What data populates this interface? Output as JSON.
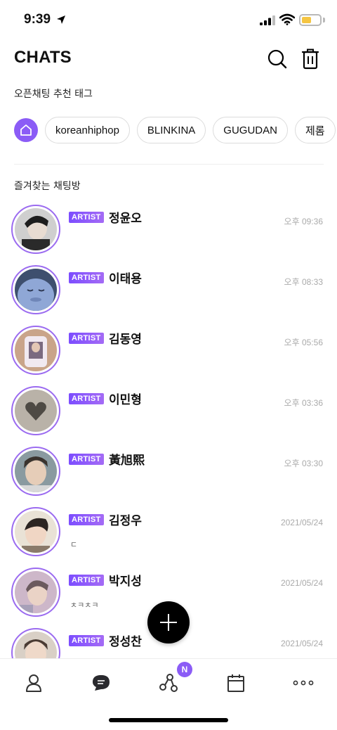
{
  "status_bar": {
    "time": "9:39",
    "battery_color": "#f5c542"
  },
  "header": {
    "title": "CHATS"
  },
  "tags_section": {
    "label": "오픈채팅 추천 태그",
    "tags": [
      "koreanhiphop",
      "BLINKINA",
      "GUGUDAN",
      "제롬"
    ]
  },
  "favorites_section": {
    "label": "즐겨찾는 채팅방"
  },
  "chats": [
    {
      "badge": "ARTIST",
      "name": "정윤오",
      "time": "오후 09:36",
      "preview": ""
    },
    {
      "badge": "ARTIST",
      "name": "이태용",
      "time": "오후 08:33",
      "preview": ""
    },
    {
      "badge": "ARTIST",
      "name": "김동영",
      "time": "오후 05:56",
      "preview": ""
    },
    {
      "badge": "ARTIST",
      "name": "이민형",
      "time": "오후 03:36",
      "preview": ""
    },
    {
      "badge": "ARTIST",
      "name": "黃旭熙",
      "time": "오후 03:30",
      "preview": ""
    },
    {
      "badge": "ARTIST",
      "name": "김정우",
      "time": "2021/05/24",
      "preview": "ㄷ"
    },
    {
      "badge": "ARTIST",
      "name": "박지성",
      "time": "2021/05/24",
      "preview": "ㅊㅋㅊㅋ"
    },
    {
      "badge": "ARTIST",
      "name": "정성찬",
      "time": "2021/05/24",
      "preview": ""
    }
  ],
  "bottom_nav": {
    "items": [
      "person-icon",
      "chat-bubble-icon",
      "share-network-icon",
      "calendar-icon",
      "more-icon"
    ],
    "badge": "N",
    "accent": "#8b5cf6"
  }
}
